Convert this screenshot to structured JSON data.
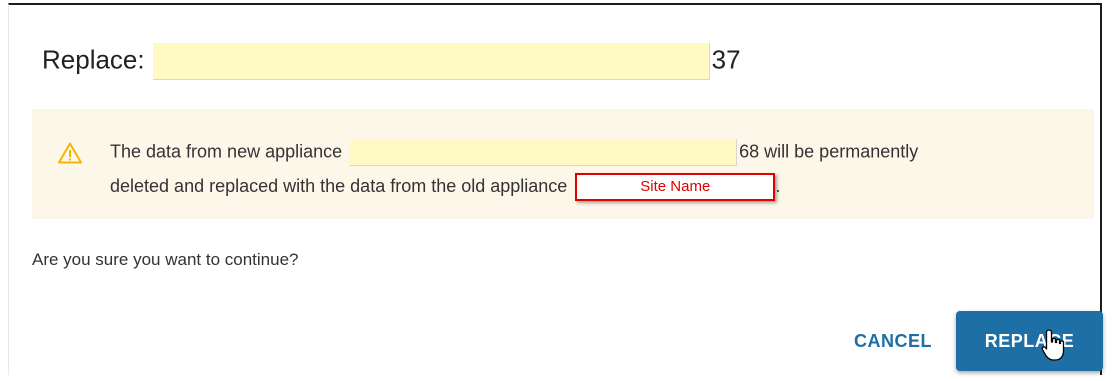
{
  "dialog": {
    "title_prefix": "Replace:",
    "title_suffix": "37",
    "warning": {
      "icon": "warning-triangle-icon",
      "line1_prefix": "The data from new appliance",
      "line1_suffix": "68 will be permanently",
      "line2_prefix": "deleted and replaced with the data from the old appliance",
      "site_tag": "Site Name",
      "line2_suffix": "."
    },
    "confirm_text": "Are you sure you want to continue?",
    "buttons": {
      "cancel_label": "CANCEL",
      "replace_label": "REPLACE"
    }
  },
  "colors": {
    "primary": "#1d6fa5",
    "warning_bg": "#fdf7ea",
    "warning_icon": "#f2b705",
    "redaction": "#fff9c4",
    "annotation_red": "#e10000"
  },
  "cursor": "hand-pointer-icon"
}
